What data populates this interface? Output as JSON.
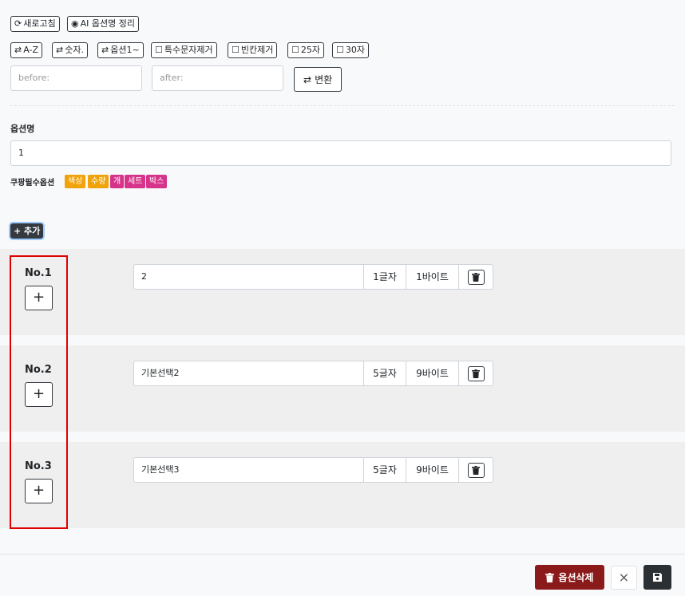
{
  "toolbar": {
    "refresh_label": "새로고침",
    "ai_label": "AI 옵션명 정리",
    "sort_az_label": "A-Z",
    "sort_num_label": "숫자.",
    "sort_option_label": "옵션1~",
    "remove_special_label": "특수문자제거",
    "remove_space_label": "빈칸제거",
    "limit25_label": "25자",
    "limit30_label": "30자"
  },
  "replace": {
    "before_placeholder": "before:",
    "after_placeholder": "after:",
    "convert_label": "변환"
  },
  "option_name": {
    "label": "옵션명",
    "value": "1"
  },
  "coupang": {
    "label": "쿠팡필수옵션",
    "tags": [
      {
        "text": "색상",
        "color": "#f0a30a"
      },
      {
        "text": "수량",
        "color": "#f0a30a"
      },
      {
        "text": "개",
        "color": "#d6338a"
      },
      {
        "text": "세트",
        "color": "#d6338a"
      },
      {
        "text": "박스",
        "color": "#d6338a"
      }
    ]
  },
  "add_label": "+ 추가",
  "rows": [
    {
      "no": "No.1",
      "value": "2",
      "chars": "1글자",
      "bytes": "1바이트"
    },
    {
      "no": "No.2",
      "value": "기본선택2",
      "chars": "5글자",
      "bytes": "9바이트"
    },
    {
      "no": "No.3",
      "value": "기본선택3",
      "chars": "5글자",
      "bytes": "9바이트"
    }
  ],
  "footer": {
    "delete_label": "옵션삭제",
    "delete_color": "#8b1a1a",
    "close_symbol": "×"
  }
}
